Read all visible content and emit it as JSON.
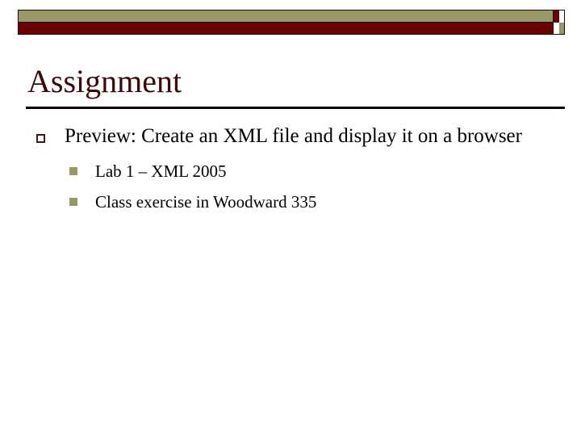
{
  "slide": {
    "title": "Assignment",
    "decoration": {
      "band_khaki_color": "#999966",
      "band_maroon_color": "#6b0000",
      "outline_color": "#1a0a0a"
    },
    "title_color": "#3d0a0a",
    "rule_color": "#120404",
    "bullets": [
      {
        "level": 1,
        "marker": "hollow-square-bullet-icon",
        "marker_color": "#4a1414",
        "text": "Preview: Create an XML file and display it on a browser",
        "children": [
          {
            "level": 2,
            "marker": "filled-square-bullet-icon",
            "marker_color": "#999966",
            "text": "Lab 1 – XML 2005"
          },
          {
            "level": 2,
            "marker": "filled-square-bullet-icon",
            "marker_color": "#999966",
            "text": "Class exercise in Woodward 335"
          }
        ]
      }
    ]
  }
}
